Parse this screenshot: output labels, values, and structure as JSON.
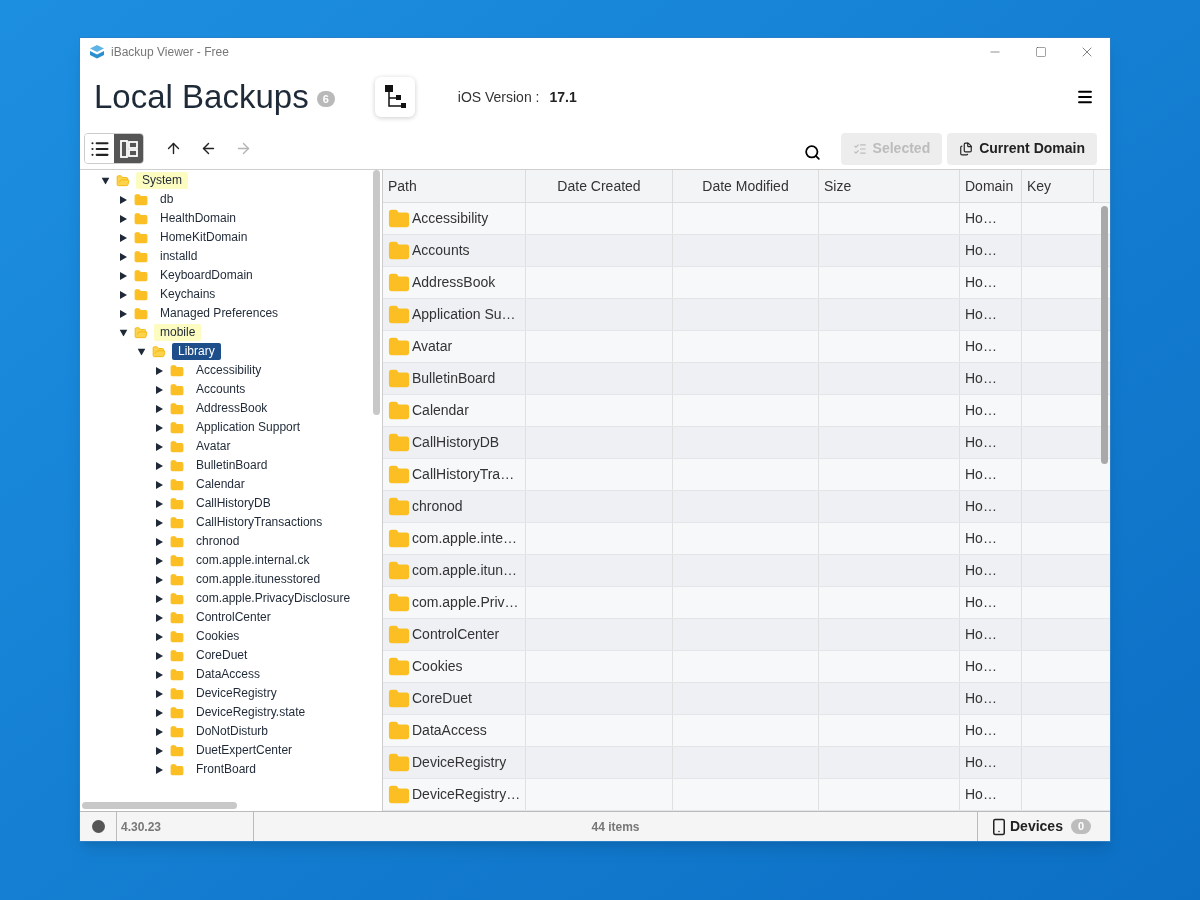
{
  "window": {
    "title": "iBackup Viewer - Free"
  },
  "header": {
    "title": "Local Backups",
    "count": "6",
    "ios_label": "iOS Version :",
    "ios_version": "17.1"
  },
  "toolbar": {
    "view_modes": [
      {
        "kind": "list",
        "selected": false
      },
      {
        "kind": "tree",
        "selected": true
      }
    ],
    "nav": [
      {
        "kind": "up",
        "disabled": false
      },
      {
        "kind": "back",
        "disabled": false
      },
      {
        "kind": "forward",
        "disabled": true
      }
    ],
    "buttons": [
      {
        "kind": "selected",
        "label": "Selected",
        "disabled": true
      },
      {
        "kind": "domain",
        "label": "Current Domain",
        "disabled": false
      }
    ]
  },
  "tree": [
    {
      "label": "System",
      "expanded": true,
      "selected": false,
      "highlighted": true,
      "children": [
        {
          "label": "db",
          "expanded": false,
          "selected": false,
          "highlighted": false
        },
        {
          "label": "HealthDomain",
          "expanded": false,
          "selected": false,
          "highlighted": false
        },
        {
          "label": "HomeKitDomain",
          "expanded": false,
          "selected": false,
          "highlighted": false
        },
        {
          "label": "installd",
          "expanded": false,
          "selected": false,
          "highlighted": false
        },
        {
          "label": "KeyboardDomain",
          "expanded": false,
          "selected": false,
          "highlighted": false
        },
        {
          "label": "Keychains",
          "expanded": false,
          "selected": false,
          "highlighted": false
        },
        {
          "label": "Managed Preferences",
          "expanded": false,
          "selected": false,
          "highlighted": false
        },
        {
          "label": "mobile",
          "expanded": true,
          "selected": false,
          "highlighted": true,
          "children": [
            {
              "label": "Library",
              "expanded": true,
              "selected": true,
              "highlighted": false,
              "children": [
                {
                  "label": "Accessibility",
                  "expanded": false,
                  "selected": false,
                  "highlighted": false
                },
                {
                  "label": "Accounts",
                  "expanded": false,
                  "selected": false,
                  "highlighted": false
                },
                {
                  "label": "AddressBook",
                  "expanded": false,
                  "selected": false,
                  "highlighted": false
                },
                {
                  "label": "Application Support",
                  "expanded": false,
                  "selected": false,
                  "highlighted": false
                },
                {
                  "label": "Avatar",
                  "expanded": false,
                  "selected": false,
                  "highlighted": false
                },
                {
                  "label": "BulletinBoard",
                  "expanded": false,
                  "selected": false,
                  "highlighted": false
                },
                {
                  "label": "Calendar",
                  "expanded": false,
                  "selected": false,
                  "highlighted": false
                },
                {
                  "label": "CallHistoryDB",
                  "expanded": false,
                  "selected": false,
                  "highlighted": false
                },
                {
                  "label": "CallHistoryTransactions",
                  "expanded": false,
                  "selected": false,
                  "highlighted": false
                },
                {
                  "label": "chronod",
                  "expanded": false,
                  "selected": false,
                  "highlighted": false
                },
                {
                  "label": "com.apple.internal.ck",
                  "expanded": false,
                  "selected": false,
                  "highlighted": false
                },
                {
                  "label": "com.apple.itunesstored",
                  "expanded": false,
                  "selected": false,
                  "highlighted": false
                },
                {
                  "label": "com.apple.PrivacyDisclosure",
                  "expanded": false,
                  "selected": false,
                  "highlighted": false
                },
                {
                  "label": "ControlCenter",
                  "expanded": false,
                  "selected": false,
                  "highlighted": false
                },
                {
                  "label": "Cookies",
                  "expanded": false,
                  "selected": false,
                  "highlighted": false
                },
                {
                  "label": "CoreDuet",
                  "expanded": false,
                  "selected": false,
                  "highlighted": false
                },
                {
                  "label": "DataAccess",
                  "expanded": false,
                  "selected": false,
                  "highlighted": false
                },
                {
                  "label": "DeviceRegistry",
                  "expanded": false,
                  "selected": false,
                  "highlighted": false
                },
                {
                  "label": "DeviceRegistry.state",
                  "expanded": false,
                  "selected": false,
                  "highlighted": false
                },
                {
                  "label": "DoNotDisturb",
                  "expanded": false,
                  "selected": false,
                  "highlighted": false
                },
                {
                  "label": "DuetExpertCenter",
                  "expanded": false,
                  "selected": false,
                  "highlighted": false
                },
                {
                  "label": "FrontBoard",
                  "expanded": false,
                  "selected": false,
                  "highlighted": false
                }
              ]
            }
          ]
        }
      ]
    }
  ],
  "table": {
    "columns": [
      "Path",
      "Date Created",
      "Date Modified",
      "Size",
      "Domain",
      "Key"
    ],
    "rows": [
      {
        "path": "Accessibility",
        "domain": "Ho…"
      },
      {
        "path": "Accounts",
        "domain": "Ho…"
      },
      {
        "path": "AddressBook",
        "domain": "Ho…"
      },
      {
        "path": "Application Su…",
        "domain": "Ho…"
      },
      {
        "path": "Avatar",
        "domain": "Ho…"
      },
      {
        "path": "BulletinBoard",
        "domain": "Ho…"
      },
      {
        "path": "Calendar",
        "domain": "Ho…"
      },
      {
        "path": "CallHistoryDB",
        "domain": "Ho…"
      },
      {
        "path": "CallHistoryTra…",
        "domain": "Ho…"
      },
      {
        "path": "chronod",
        "domain": "Ho…"
      },
      {
        "path": "com.apple.inte…",
        "domain": "Ho…"
      },
      {
        "path": "com.apple.itun…",
        "domain": "Ho…"
      },
      {
        "path": "com.apple.Priv…",
        "domain": "Ho…"
      },
      {
        "path": "ControlCenter",
        "domain": "Ho…"
      },
      {
        "path": "Cookies",
        "domain": "Ho…"
      },
      {
        "path": "CoreDuet",
        "domain": "Ho…"
      },
      {
        "path": "DataAccess",
        "domain": "Ho…"
      },
      {
        "path": "DeviceRegistry",
        "domain": "Ho…"
      },
      {
        "path": "DeviceRegistry…",
        "domain": "Ho…"
      }
    ]
  },
  "status_bar": {
    "version": "4.30.23",
    "items": "44 items",
    "devices_label": "Devices",
    "devices_count": "0"
  }
}
